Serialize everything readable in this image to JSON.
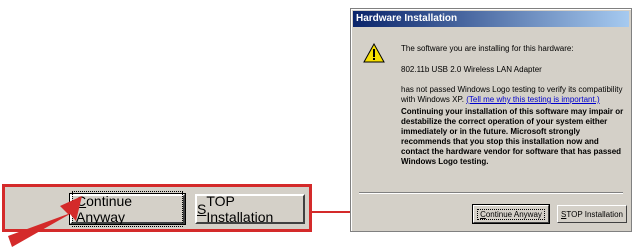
{
  "dialog": {
    "title": "Hardware Installation",
    "intro": "The software you are installing for this hardware:",
    "device_name": "802.11b USB 2.0 Wireless LAN Adapter",
    "logo_text": "has not passed Windows Logo testing to verify its compatibility with Windows XP.",
    "logo_link": "(Tell me why this testing is important.)",
    "warning": "Continuing your installation of this software may impair or destabilize the correct operation of your system either immediately or in the future. Microsoft strongly recommends that you stop this installation now and contact the hardware vendor for software that has passed Windows Logo testing.",
    "continue_label_rest": "ontinue Anyway",
    "continue_label_key": "C",
    "stop_label_key": "S",
    "stop_label_rest": "TOP Installation"
  },
  "zoom": {
    "continue_label_key": "C",
    "continue_label_rest": "ontinue Anyway",
    "stop_label_key": "S",
    "stop_label_rest": "TOP Installation"
  },
  "colors": {
    "highlight": "#d42a2a",
    "dialog_face": "#d4d0c8",
    "titlebar_start": "#0a246a",
    "titlebar_end": "#a6caf0"
  },
  "icons": [
    "warning-icon",
    "red-arrow-icon"
  ]
}
